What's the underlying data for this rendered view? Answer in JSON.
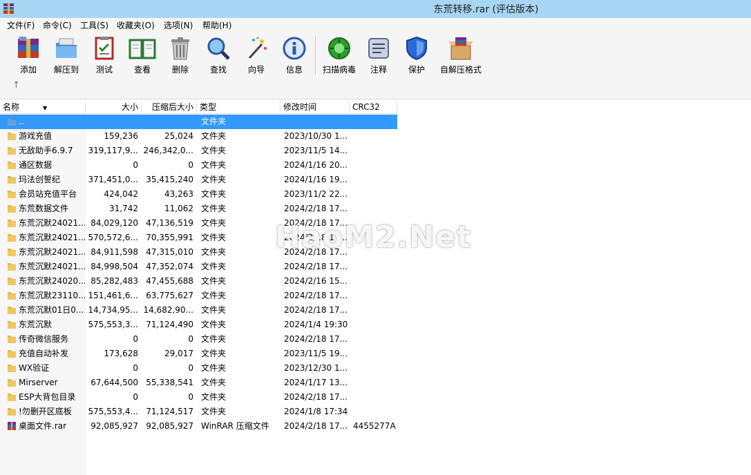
{
  "window": {
    "title": "东荒转移.rar (评估版本)"
  },
  "menu": [
    "文件(F)",
    "命令(C)",
    "工具(S)",
    "收藏夹(O)",
    "选项(N)",
    "帮助(H)"
  ],
  "toolbar": {
    "buttons": [
      {
        "label": "添加",
        "icon": "add-archive-icon"
      },
      {
        "label": "解压到",
        "icon": "extract-to-icon"
      },
      {
        "label": "测试",
        "icon": "test-icon"
      },
      {
        "label": "查看",
        "icon": "view-icon"
      },
      {
        "label": "删除",
        "icon": "delete-icon"
      },
      {
        "label": "查找",
        "icon": "find-icon"
      },
      {
        "label": "向导",
        "icon": "wizard-icon"
      },
      {
        "label": "信息",
        "icon": "info-icon"
      },
      {
        "label": "扫描病毒",
        "icon": "virus-scan-icon"
      },
      {
        "label": "注释",
        "icon": "comment-icon"
      },
      {
        "label": "保护",
        "icon": "protect-icon"
      },
      {
        "label": "自解压格式",
        "icon": "sfx-icon"
      }
    ],
    "up_symbol": "↑"
  },
  "columns": {
    "name": "名称",
    "size": "大小",
    "packed": "压缩后大小",
    "type": "类型",
    "modified": "修改时间",
    "crc": "CRC32"
  },
  "rows": [
    {
      "name": "..",
      "size": "",
      "packed": "",
      "type": "文件夹",
      "modified": "",
      "crc": "",
      "selected": true,
      "kind": "parent"
    },
    {
      "name": "游戏充值",
      "size": "159,236",
      "packed": "25,024",
      "type": "文件夹",
      "modified": "2023/10/30 1...",
      "crc": "",
      "kind": "folder"
    },
    {
      "name": "无敌助手6.9.7",
      "size": "319,117,9...",
      "packed": "246,342,0...",
      "type": "文件夹",
      "modified": "2023/11/5 14...",
      "crc": "",
      "kind": "folder"
    },
    {
      "name": "通区数据",
      "size": "0",
      "packed": "0",
      "type": "文件夹",
      "modified": "2024/1/16 20...",
      "crc": "",
      "kind": "folder"
    },
    {
      "name": "玛法创誓纪",
      "size": "371,451,0...",
      "packed": "35,415,240",
      "type": "文件夹",
      "modified": "2024/1/16 19...",
      "crc": "",
      "kind": "folder"
    },
    {
      "name": "会员站充值平台",
      "size": "424,042",
      "packed": "43,263",
      "type": "文件夹",
      "modified": "2023/11/2 22...",
      "crc": "",
      "kind": "folder"
    },
    {
      "name": "东荒数据文件",
      "size": "31,742",
      "packed": "11,062",
      "type": "文件夹",
      "modified": "2024/2/18 17...",
      "crc": "",
      "kind": "folder"
    },
    {
      "name": "东荒沉默24021...",
      "size": "84,029,120",
      "packed": "47,136,519",
      "type": "文件夹",
      "modified": "2024/2/18 17...",
      "crc": "",
      "kind": "folder"
    },
    {
      "name": "东荒沉默24021...",
      "size": "570,572,6...",
      "packed": "70,355,991",
      "type": "文件夹",
      "modified": "2024/2/18 17...",
      "crc": "",
      "kind": "folder"
    },
    {
      "name": "东荒沉默24021...",
      "size": "84,911,598",
      "packed": "47,315,010",
      "type": "文件夹",
      "modified": "2024/2/18 17...",
      "crc": "",
      "kind": "folder"
    },
    {
      "name": "东荒沉默24021...",
      "size": "84,998,504",
      "packed": "47,352,074",
      "type": "文件夹",
      "modified": "2024/2/18 17...",
      "crc": "",
      "kind": "folder"
    },
    {
      "name": "东荒沉默24020...",
      "size": "85,282,483",
      "packed": "47,455,688",
      "type": "文件夹",
      "modified": "2024/2/16 15...",
      "crc": "",
      "kind": "folder"
    },
    {
      "name": "东荒沉默23110...",
      "size": "151,461,6...",
      "packed": "63,775,627",
      "type": "文件夹",
      "modified": "2024/2/18 17...",
      "crc": "",
      "kind": "folder"
    },
    {
      "name": "东荒沉默01日0...",
      "size": "14,734,95...",
      "packed": "14,682,90...",
      "type": "文件夹",
      "modified": "2024/2/18 17...",
      "crc": "",
      "kind": "folder"
    },
    {
      "name": "东荒沉默",
      "size": "575,553,3...",
      "packed": "71,124,490",
      "type": "文件夹",
      "modified": "2024/1/4 19:30",
      "crc": "",
      "kind": "folder"
    },
    {
      "name": "传奇微信服务",
      "size": "0",
      "packed": "0",
      "type": "文件夹",
      "modified": "2024/2/18 17...",
      "crc": "",
      "kind": "folder"
    },
    {
      "name": "充值自动补发",
      "size": "173,628",
      "packed": "29,017",
      "type": "文件夹",
      "modified": "2023/11/5 19...",
      "crc": "",
      "kind": "folder"
    },
    {
      "name": "WX验证",
      "size": "0",
      "packed": "0",
      "type": "文件夹",
      "modified": "2023/12/30 1...",
      "crc": "",
      "kind": "folder"
    },
    {
      "name": "Mirserver",
      "size": "67,644,500",
      "packed": "55,338,541",
      "type": "文件夹",
      "modified": "2024/1/17 13...",
      "crc": "",
      "kind": "folder"
    },
    {
      "name": "ESP大背包目录",
      "size": "0",
      "packed": "0",
      "type": "文件夹",
      "modified": "2024/2/18 17...",
      "crc": "",
      "kind": "folder"
    },
    {
      "name": "!勿删开区底板",
      "size": "575,553,4...",
      "packed": "71,124,517",
      "type": "文件夹",
      "modified": "2024/1/8 17:34",
      "crc": "",
      "kind": "folder"
    },
    {
      "name": "桌面文件.rar",
      "size": "92,085,927",
      "packed": "92,085,927",
      "type": "WinRAR 压缩文件",
      "modified": "2024/2/18 17...",
      "crc": "4455277A",
      "kind": "rar"
    }
  ],
  "watermark": "HaoM2.Net",
  "colors": {
    "titlebar": "#a7d6f3",
    "selection": "#3399ff",
    "folder": "#e8b84a"
  }
}
